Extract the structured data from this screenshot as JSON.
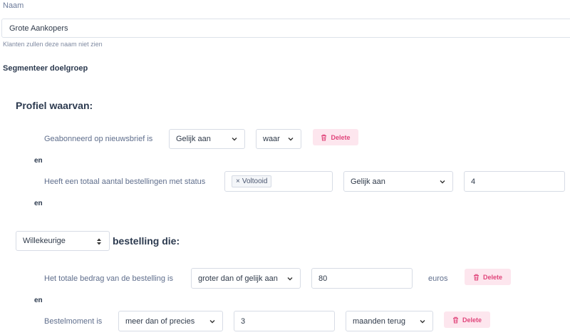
{
  "form": {
    "name_label": "Naam",
    "name_value": "Grote Aankopers",
    "name_hint": "Klanten zullen deze naam niet zien",
    "segment_title": "Segmenteer doelgroep"
  },
  "profile": {
    "heading": "Profiel waarvan:",
    "conditions": [
      {
        "label": "Geabonneerd op nieuwsbrief is",
        "operator": "Gelijk aan",
        "value": "waar",
        "delete_label": "Delete"
      },
      {
        "label": "Heeft een totaal aantal bestellingen met status",
        "tag": "Voltooid",
        "tag_remove": "×",
        "operator": "Gelijk aan",
        "value": "4"
      }
    ],
    "connector": "en"
  },
  "order": {
    "quantifier": "Willekeurige",
    "heading": "bestelling die:",
    "conditions": [
      {
        "label": "Het totale bedrag van de bestelling is",
        "operator": "groter dan of gelijk aan",
        "value": "80",
        "unit": "euros",
        "delete_label": "Delete"
      },
      {
        "label": "Bestelmoment is",
        "operator": "meer dan of precies",
        "value": "3",
        "unit_select": "maanden terug",
        "delete_label": "Delete"
      }
    ],
    "connector": "en"
  },
  "colors": {
    "delete_bg": "#fde6ee",
    "delete_text": "#e0457b",
    "border": "#d7dce5"
  }
}
